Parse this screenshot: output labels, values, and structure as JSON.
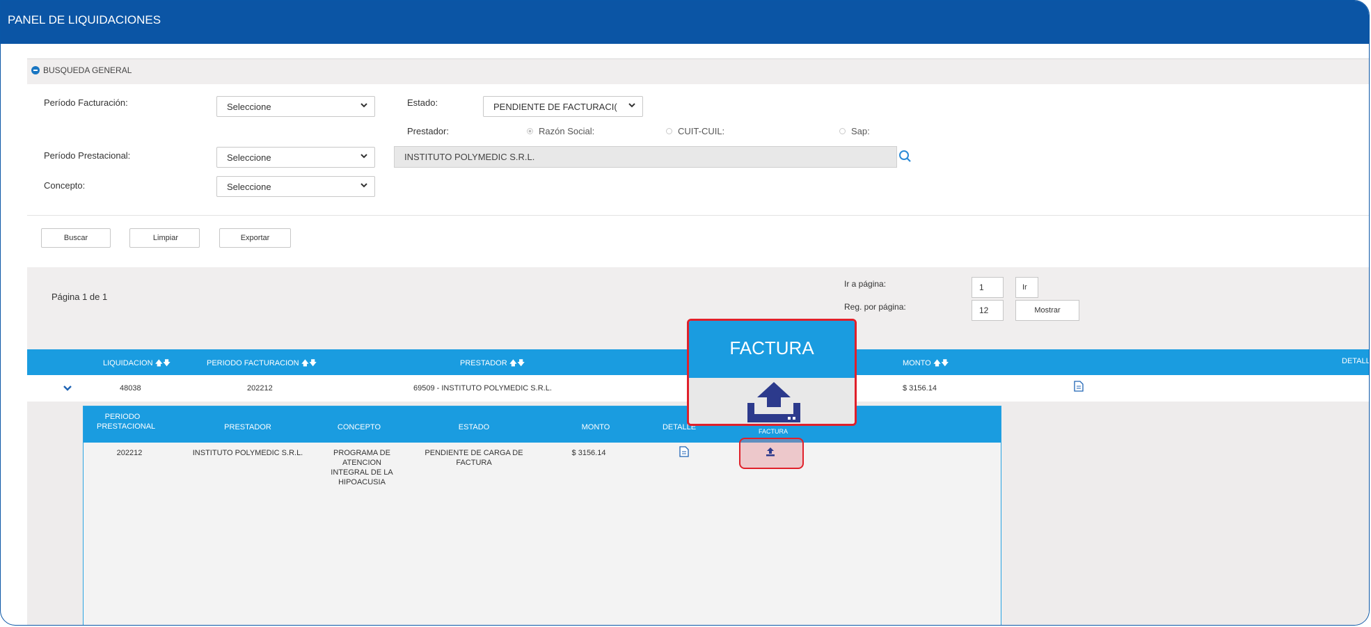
{
  "header": {
    "title": "PANEL DE LIQUIDACIONES"
  },
  "search": {
    "section_title": "BUSQUEDA GENERAL",
    "periodo_facturacion_label": "Período Facturación:",
    "periodo_facturacion_value": "Seleccione",
    "estado_label": "Estado:",
    "estado_value": "PENDIENTE DE FACTURACI(",
    "prestador_label": "Prestador:",
    "radio_razon_social": "Razón Social:",
    "radio_cuit_cuil": "CUIT-CUIL:",
    "radio_sap": "Sap:",
    "periodo_prestacional_label": "Período Prestacional:",
    "periodo_prestacional_value": "Seleccione",
    "prestador_value": "INSTITUTO POLYMEDIC S.R.L.",
    "concepto_label": "Concepto:",
    "concepto_value": "Seleccione"
  },
  "actions": {
    "buscar": "Buscar",
    "limpiar": "Limpiar",
    "exportar": "Exportar"
  },
  "pager": {
    "page_text": "Página 1 de 1",
    "goto_label": "Ir a página:",
    "goto_value": "1",
    "goto_button": "Ir",
    "per_page_label": "Reg. por página:",
    "per_page_value": "12",
    "show_button": "Mostrar"
  },
  "table": {
    "columns": [
      "LIQUIDACION",
      "PERIODO FACTURACION",
      "PRESTADOR",
      "MONTO",
      "DETALLE"
    ],
    "row": {
      "liquidacion": "48038",
      "periodo_facturacion": "202212",
      "prestador": "69509 - INSTITUTO POLYMEDIC S.R.L.",
      "monto": "$ 3156.14"
    }
  },
  "subtable": {
    "columns": [
      "PERIODO PRESTACIONAL",
      "PRESTADOR",
      "CONCEPTO",
      "ESTADO",
      "MONTO",
      "DETALLE",
      "FACTURA"
    ],
    "row": {
      "periodo_prestacional": "202212",
      "prestador": "INSTITUTO POLYMEDIC S.R.L.",
      "concepto": "PROGRAMA DE ATENCION INTEGRAL DE LA HIPOACUSIA",
      "estado": "PENDIENTE DE CARGA DE FACTURA",
      "monto": "$ 3156.14"
    }
  },
  "callout": {
    "title": "FACTURA"
  },
  "colors": {
    "header_blue": "#0b55a5",
    "table_blue": "#1a9ce0",
    "highlight_red": "#e0202a",
    "icon_navy": "#2c3a8c"
  },
  "icons": [
    "minus-circle-icon",
    "chevron-down-icon",
    "search-icon",
    "document-icon",
    "upload-icon"
  ]
}
